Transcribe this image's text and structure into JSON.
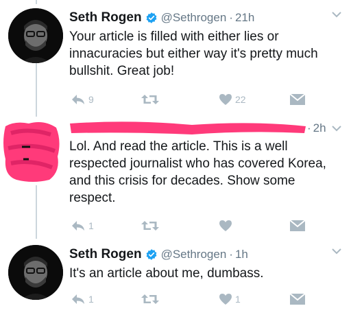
{
  "tweets": [
    {
      "name": "Seth Rogen",
      "handle": "@Sethrogen",
      "time": "21h",
      "text": "Your article is filled with either lies or innacuracies but either way it's pretty much bullshit. Great job!",
      "reply_count": "9",
      "retweet_count": "",
      "like_count": "22"
    },
    {
      "time": "2h",
      "text": "Lol. And read the article. This is a well respected journalist who has covered Korea, and this crisis for decades. Show some respect.",
      "reply_count": "1",
      "retweet_count": "",
      "like_count": ""
    },
    {
      "name": "Seth Rogen",
      "handle": "@Sethrogen",
      "time": "1h",
      "text": "It's an article about me, dumbass.",
      "reply_count": "1",
      "retweet_count": "",
      "like_count": "1"
    }
  ],
  "colors": {
    "verified": "#1da1f2",
    "muted": "#aab8c2",
    "handle": "#657786",
    "redaction": "#ff3a7a"
  },
  "icons": [
    "reply-icon",
    "retweet-icon",
    "like-icon",
    "direct-message-icon",
    "verified-badge-icon",
    "chevron-down-icon"
  ]
}
